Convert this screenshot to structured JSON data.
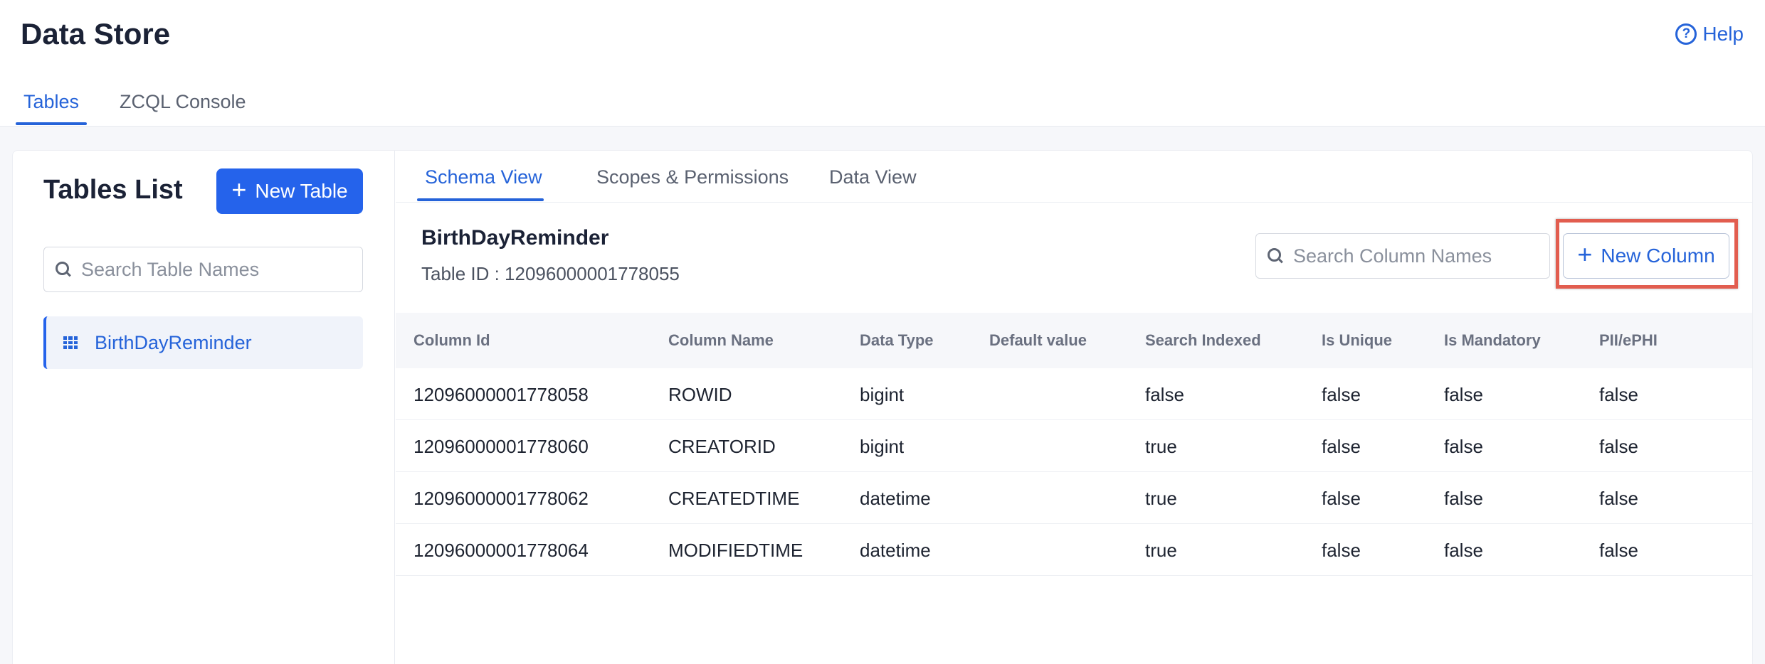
{
  "header": {
    "title": "Data Store",
    "help_label": "Help",
    "help_icon": "question-circle-icon"
  },
  "main_tabs": [
    {
      "label": "Tables",
      "active": true
    },
    {
      "label": "ZCQL Console",
      "active": false
    }
  ],
  "sidebar": {
    "title": "Tables List",
    "new_table_label": "New Table",
    "search_placeholder": "Search Table Names",
    "tables": [
      {
        "name": "BirthDayReminder",
        "icon": "table-grid-icon",
        "selected": true
      }
    ]
  },
  "sub_tabs": [
    {
      "label": "Schema View",
      "active": true
    },
    {
      "label": "Scopes & Permissions",
      "active": false
    },
    {
      "label": "Data View",
      "active": false
    }
  ],
  "schema": {
    "table_name": "BirthDayReminder",
    "table_id_text": "Table ID : 12096000001778055",
    "search_placeholder": "Search Column Names",
    "new_column_label": "New Column",
    "columns": [
      "Column Id",
      "Column Name",
      "Data Type",
      "Default value",
      "Search Indexed",
      "Is Unique",
      "Is Mandatory",
      "PII/ePHI"
    ],
    "rows": [
      [
        "12096000001778058",
        "ROWID",
        "bigint",
        "",
        "false",
        "false",
        "false",
        "false"
      ],
      [
        "12096000001778060",
        "CREATORID",
        "bigint",
        "",
        "true",
        "false",
        "false",
        "false"
      ],
      [
        "12096000001778062",
        "CREATEDTIME",
        "datetime",
        "",
        "true",
        "false",
        "false",
        "false"
      ],
      [
        "12096000001778064",
        "MODIFIEDTIME",
        "datetime",
        "",
        "true",
        "false",
        "false",
        "false"
      ]
    ]
  },
  "colors": {
    "accent": "#2563eb",
    "highlight": "#e25d4f"
  }
}
